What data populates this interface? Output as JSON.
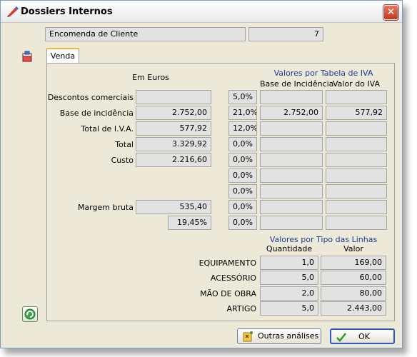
{
  "window": {
    "title": "Dossiers Internos",
    "close_label": "✕"
  },
  "header": {
    "doc_type": "Encomenda de Cliente",
    "doc_number": "7"
  },
  "tabs": [
    {
      "label": "Venda"
    }
  ],
  "left": {
    "heading": "Em Euros",
    "rows": [
      {
        "label": "Descontos comerciais",
        "value": ""
      },
      {
        "label": "Base de incidência",
        "value": "2.752,00"
      },
      {
        "label": "Total de I.V.A.",
        "value": "577,92"
      },
      {
        "label": "Total",
        "value": "3.329,92"
      },
      {
        "label": "Custo",
        "value": "2.216,60"
      },
      {
        "label": "",
        "value": ""
      },
      {
        "label": "",
        "value": ""
      },
      {
        "label": "Margem bruta",
        "value": "535,40"
      },
      {
        "label": "",
        "value": "19,45%"
      }
    ]
  },
  "iva": {
    "title": "Valores por Tabela de IVA",
    "col_base": "Base de Incidência",
    "col_valor": "Valor do IVA",
    "rows": [
      {
        "rate": "5,0%",
        "base": "",
        "valor": ""
      },
      {
        "rate": "21,0%",
        "base": "2.752,00",
        "valor": "577,92"
      },
      {
        "rate": "12,0%",
        "base": "",
        "valor": ""
      },
      {
        "rate": "0,0%",
        "base": "",
        "valor": ""
      },
      {
        "rate": "0,0%",
        "base": "",
        "valor": ""
      },
      {
        "rate": "0,0%",
        "base": "",
        "valor": ""
      },
      {
        "rate": "0,0%",
        "base": "",
        "valor": ""
      },
      {
        "rate": "0,0%",
        "base": "",
        "valor": ""
      },
      {
        "rate": "0,0%",
        "base": "",
        "valor": ""
      }
    ]
  },
  "lines": {
    "title": "Valores por Tipo das Linhas",
    "col_qty": "Quantidade",
    "col_val": "Valor",
    "rows": [
      {
        "type": "EQUIPAMENTO",
        "qty": "1,0",
        "val": "169,00"
      },
      {
        "type": "ACESSÓRIO",
        "qty": "5,0",
        "val": "60,00"
      },
      {
        "type": "MÃO DE OBRA",
        "qty": "2,0",
        "val": "80,00"
      },
      {
        "type": "ARTIGO",
        "qty": "5,0",
        "val": "2.443,00"
      }
    ]
  },
  "buttons": {
    "other_analyses": "Outras análises",
    "ok": "OK"
  },
  "icons": {
    "title": "pencil-icon",
    "side": "cube-icon",
    "refresh": "refresh-icon",
    "other": "magic-icon",
    "ok": "check-icon"
  }
}
